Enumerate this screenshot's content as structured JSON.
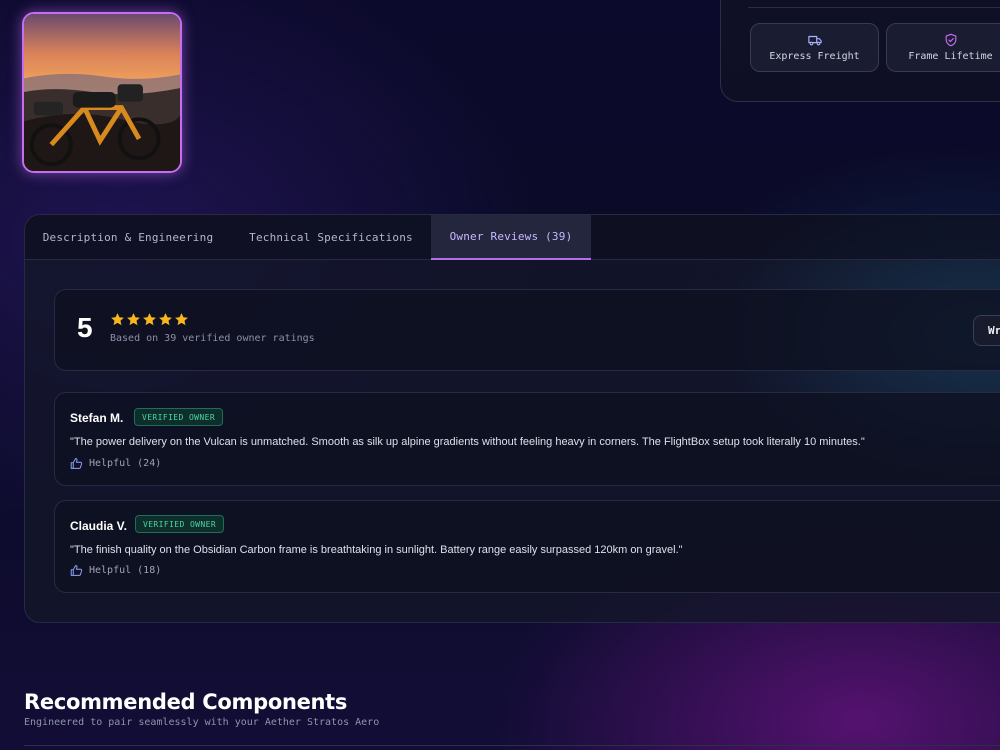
{
  "product_image": {
    "alt": "Bikepacking e-bike on a ridge at sunset",
    "accent_border": "#c56ef2"
  },
  "shipping": {
    "badges": [
      {
        "icon": "truck-icon",
        "label": "Express Freight",
        "icon_color": "#a9b4ff"
      },
      {
        "icon": "shield-check-icon",
        "label": "Frame Lifetime",
        "icon_color": "#c56ef2"
      }
    ]
  },
  "tabs": [
    {
      "label": "Description & Engineering",
      "active": false
    },
    {
      "label": "Technical Specifications",
      "active": false
    },
    {
      "label": "Owner Reviews (39)",
      "active": true
    }
  ],
  "rating_summary": {
    "score": "5",
    "stars": 5,
    "star_color": "#f5b81c",
    "based_on": "Based on 39 verified owner ratings",
    "write_button": "Wr"
  },
  "reviews": [
    {
      "author": "Stefan M.",
      "badge": "VERIFIED OWNER",
      "text": "\"The power delivery on the Vulcan is unmatched. Smooth as silk up alpine gradients without feeling heavy in corners. The FlightBox setup took literally 10 minutes.\"",
      "helpful": "Helpful (24)"
    },
    {
      "author": "Claudia V.",
      "badge": "VERIFIED OWNER",
      "text": "\"The finish quality on the Obsidian Carbon frame is breathtaking in sunlight. Battery range easily surpassed 120km on gravel.\"",
      "helpful": "Helpful (18)"
    }
  ],
  "recommended": {
    "title": "Recommended Components",
    "subtitle": "Engineered to pair seamlessly with your Aether Stratos Aero"
  },
  "colors": {
    "accent_purple": "#b76cf0",
    "verified_green": "#4fd5a4",
    "background": "#0c0a2c"
  }
}
